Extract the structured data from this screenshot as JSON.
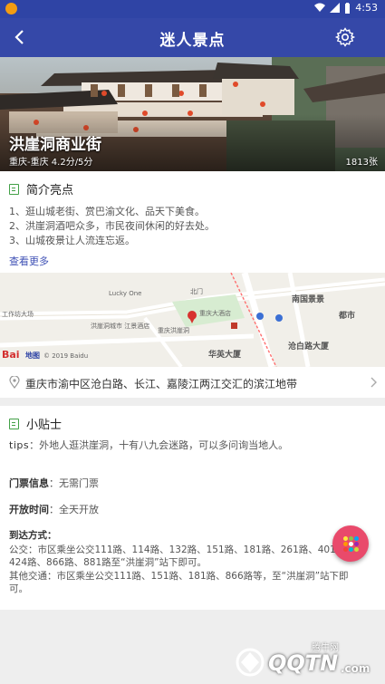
{
  "status_bar": {
    "time": "4:53",
    "icons": [
      "wifi-icon",
      "signal-icon",
      "battery-icon"
    ]
  },
  "app_bar": {
    "title": "迷人景点",
    "back_icon": "back-arrow-icon",
    "settings_icon": "gear-icon"
  },
  "hero": {
    "name": "洪崖洞商业街",
    "subtitle": "重庆-重庆 4.2分/5分",
    "photo_count": "1813张"
  },
  "intro": {
    "heading": "简介亮点",
    "lines": [
      "1、逛山城老街、赏巴渝文化、品天下美食。",
      "2、洪崖洞酒吧众多，市民夜间休闲的好去处。",
      "3、山城夜景让人流连忘返。"
    ],
    "more_link": "查看更多"
  },
  "map": {
    "labels": {
      "lucky_one": "Lucky One",
      "hotel": "重庆大酒店",
      "street1": "北门",
      "nanguo": "南国景景",
      "dushi": "都市",
      "huaying": "华英大厦",
      "cangbai": "沧白路大厦",
      "gate": "工作坊大场",
      "jiangbin": "洪崖洞城市\n江景酒店",
      "baidu": "Bai",
      "baidu2": "地图",
      "copyright": "© 2019 Baidu",
      "chongqing_hongya": "重庆洪崖洞"
    }
  },
  "address": {
    "text": "重庆市渝中区沧白路、长江、嘉陵江两江交汇的滨江地带"
  },
  "tips": {
    "heading": "小贴士",
    "tip_label": "tips",
    "tip_text": "：外地人逛洪崖洞，十有八九会迷路，可以多问询当地人。",
    "ticket_label": "门票信息",
    "ticket_value": "：无需门票",
    "hours_label": "开放时间",
    "hours_value": "：全天开放",
    "arrive_label": "到达方式：",
    "bus_lines": "公交：市区乘坐公交111路、114路、132路、151路、181路、261路、401路、424路、866路、881路至“洪崖洞”站下即可。",
    "other_lines": "其他交通：市区乘坐公交111路、151路、181路、866路等，至“洪崖洞”站下即可。"
  },
  "watermark": {
    "brand": "QQTN",
    "suffix": ".com",
    "tag": "腾牛网"
  },
  "colors": {
    "app_bar": "#3548a8",
    "status_bar": "#2f44a5",
    "fab": "#e94a6b",
    "link": "#3f51b5",
    "icon_green": "#43a047"
  }
}
